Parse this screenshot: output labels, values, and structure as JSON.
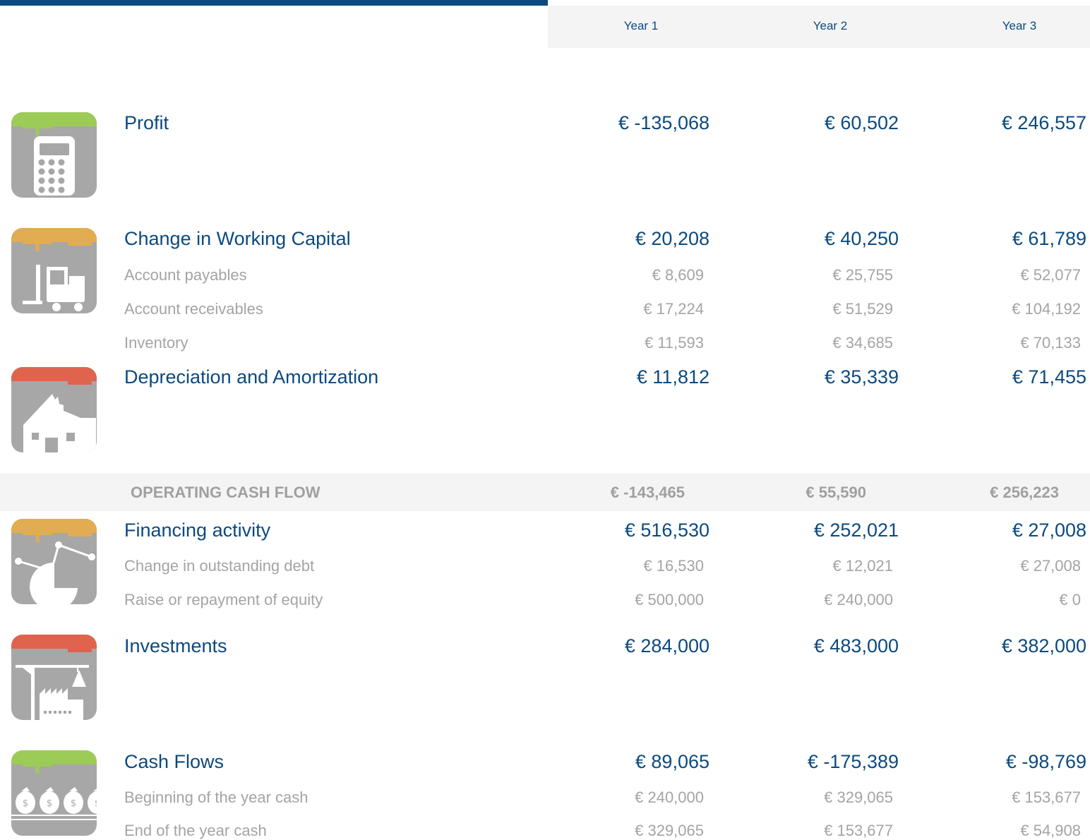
{
  "header": {
    "years": [
      "Year 1",
      "Year 2",
      "Year 3"
    ]
  },
  "colors": {
    "accent": "#0b4a80",
    "muted": "#a4a4a4",
    "green": "#9dcb57",
    "orange": "#e2ac52",
    "red": "#e0634e",
    "icon_gray": "#a7a7a7"
  },
  "sections": {
    "profit": {
      "icon": "calculator-icon",
      "title": "Profit",
      "values": [
        "€ -135,068",
        "€ 60,502",
        "€ 246,557"
      ]
    },
    "working_capital": {
      "icon": "forklift-icon",
      "title": "Change in Working Capital",
      "values": [
        "€ 20,208",
        "€ 40,250",
        "€ 61,789"
      ],
      "rows": [
        {
          "label": "Account payables",
          "values": [
            "€ 8,609",
            "€ 25,755",
            "€ 52,077"
          ]
        },
        {
          "label": "Account receivables",
          "values": [
            "€ 17,224",
            "€ 51,529",
            "€ 104,192"
          ]
        },
        {
          "label": "Inventory",
          "values": [
            "€ 11,593",
            "€ 34,685",
            "€ 70,133"
          ]
        }
      ]
    },
    "depreciation": {
      "icon": "broken-building-icon",
      "title": "Depreciation and Amortization",
      "values": [
        "€ 11,812",
        "€ 35,339",
        "€ 71,455"
      ]
    },
    "operating_cash_flow": {
      "label": "OPERATING CASH FLOW",
      "values": [
        "€ -143,465",
        "€ 55,590",
        "€ 256,223"
      ]
    },
    "financing": {
      "icon": "pie-chart-icon",
      "title": "Financing activity",
      "values": [
        "€ 516,530",
        "€ 252,021",
        "€ 27,008"
      ],
      "rows": [
        {
          "label": "Change in outstanding debt",
          "values": [
            "€ 16,530",
            "€ 12,021",
            "€ 27,008"
          ]
        },
        {
          "label": "Raise or repayment of equity",
          "values": [
            "€ 500,000",
            "€ 240,000",
            "€ 0"
          ]
        }
      ]
    },
    "investments": {
      "icon": "factory-crane-icon",
      "title": "Investments",
      "values": [
        "€ 284,000",
        "€ 483,000",
        "€ 382,000"
      ]
    },
    "cash_flows": {
      "icon": "money-bags-icon",
      "title": "Cash Flows",
      "values": [
        "€ 89,065",
        "€ -175,389",
        "€ -98,769"
      ],
      "rows": [
        {
          "label": "Beginning of the year cash",
          "values": [
            "€ 240,000",
            "€ 329,065",
            "€ 153,677"
          ]
        },
        {
          "label": "End of the year cash",
          "values": [
            "€ 329,065",
            "€ 153,677",
            "€ 54,908"
          ]
        }
      ]
    }
  }
}
